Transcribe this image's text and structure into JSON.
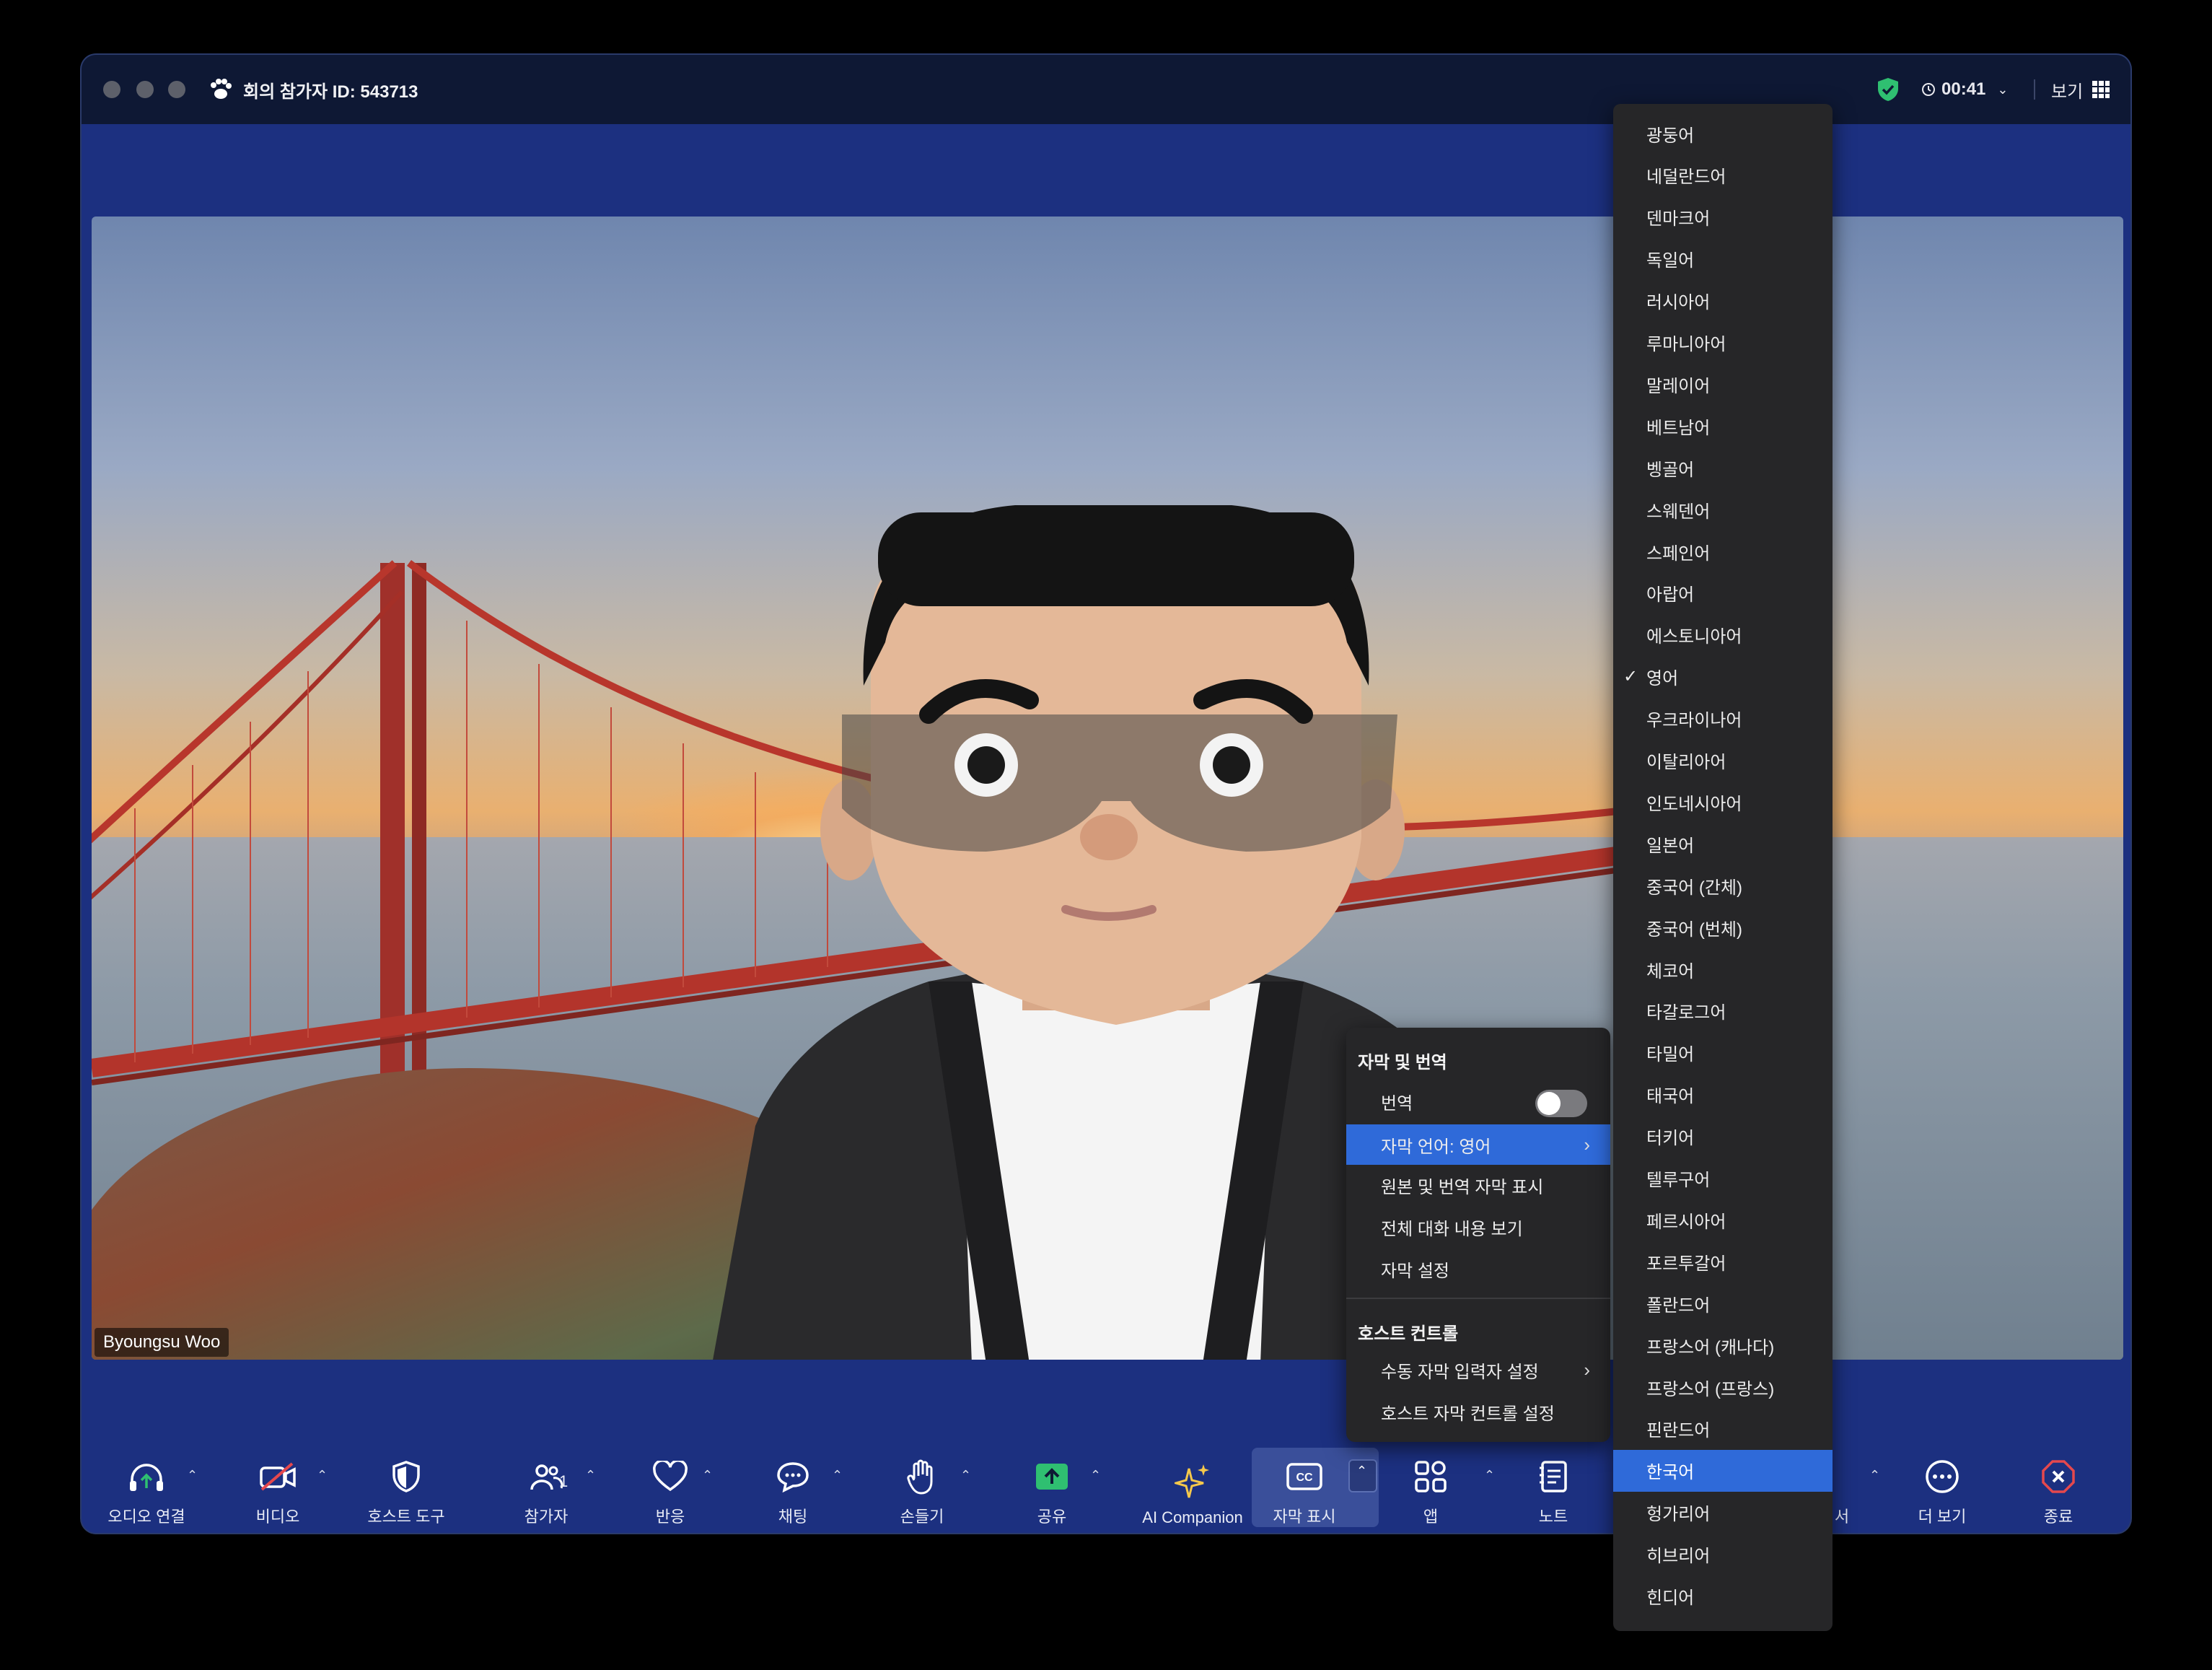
{
  "window": {
    "title": "회의 참가자 ID: 543713",
    "timer": "00:41",
    "view_label": "보기"
  },
  "video": {
    "participant_name": "Byoungsu Woo"
  },
  "toolbar": {
    "audio": "오디오 연결",
    "video": "비디오",
    "host_tools": "호스트 도구",
    "participants": "참가자",
    "participants_count": "1",
    "reactions": "반응",
    "chat": "채팅",
    "raise_hand": "손들기",
    "share": "공유",
    "ai_companion": "AI Companion",
    "captions": "자막 표시",
    "apps": "앱",
    "notes": "노트",
    "hidden_partial": "서",
    "more": "더 보기",
    "end": "종료"
  },
  "caption_menu": {
    "section1": "자막 및 번역",
    "translation": "번역",
    "caption_language": "자막 언어: 영어",
    "show_original_translated": "원본 및 번역 자막 표시",
    "view_transcript": "전체 대화 내용 보기",
    "caption_settings": "자막 설정",
    "section2": "호스트 컨트롤",
    "manual_caption": "수동 자막 입력자 설정",
    "host_caption_control": "호스트 자막 컨트롤 설정"
  },
  "languages": [
    "광둥어",
    "네덜란드어",
    "덴마크어",
    "독일어",
    "러시아어",
    "루마니아어",
    "말레이어",
    "베트남어",
    "벵골어",
    "스웨덴어",
    "스페인어",
    "아랍어",
    "에스토니아어",
    "영어",
    "우크라이나어",
    "이탈리아어",
    "인도네시아어",
    "일본어",
    "중국어 (간체)",
    "중국어 (번체)",
    "체코어",
    "타갈로그어",
    "타밀어",
    "태국어",
    "터키어",
    "텔루구어",
    "페르시아어",
    "포르투갈어",
    "폴란드어",
    "프랑스어 (캐나다)",
    "프랑스어 (프랑스)",
    "핀란드어",
    "한국어",
    "헝가리어",
    "히브리어",
    "힌디어"
  ],
  "language_checked": "영어",
  "language_highlighted": "한국어",
  "colors": {
    "window_bg": "#1c3080",
    "titlebar": "#0e1834",
    "menu_bg": "#262628",
    "accent": "#2f6ad9",
    "end_red": "#e5484d",
    "share_green": "#2fbf71"
  }
}
